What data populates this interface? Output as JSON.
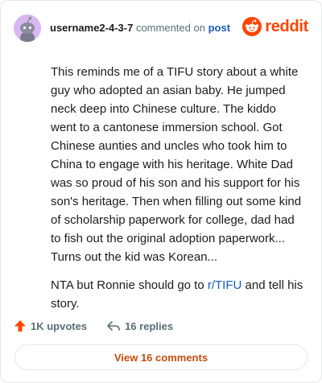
{
  "header": {
    "username": "username2-4-3-7",
    "action_text": "commented on",
    "post_link": "post",
    "brand_word": "reddit"
  },
  "comment": {
    "paragraph1": "This reminds me of a TIFU story about a white guy who adopted an asian baby. He jumped neck deep into Chinese culture. The kiddo went to a cantonese immersion school. Got Chinese aunties and uncles who took him to China to engage with his heritage. White Dad was so proud of his son and his support for his son's heritage. Then when filling out some kind of scholarship paperwork for college, dad had to fish out the original adoption paperwork... Turns out the kid was Korean...",
    "paragraph2_before": "NTA but Ronnie should go to ",
    "paragraph2_link": "r/TIFU",
    "paragraph2_after": " and tell his story."
  },
  "actions": {
    "upvotes": "1K upvotes",
    "replies": "16 replies"
  },
  "view_comments_label": "View 16 comments",
  "colors": {
    "brand": "#ff4500",
    "link": "#1a5cb7",
    "button_text": "#c74a0f",
    "avatar_bg": "#d9b8f2"
  },
  "icons": [
    "avatar",
    "reddit-logo-icon",
    "upvote-arrow-icon",
    "reply-arrow-icon"
  ]
}
